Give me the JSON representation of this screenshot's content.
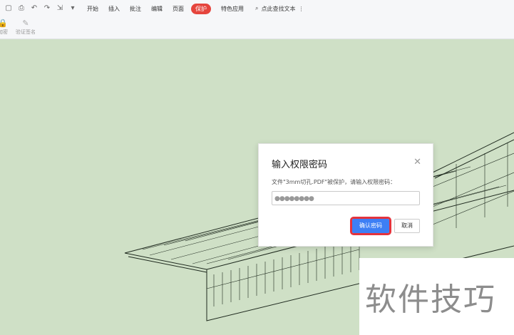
{
  "toolbar": {
    "menus": [
      "开始",
      "插入",
      "批注",
      "编辑",
      "页面",
      "保护",
      "特色应用"
    ],
    "active_menu": "保护",
    "search_label": "点此查找文本",
    "tools": [
      "加密",
      "验证签名"
    ]
  },
  "dialog": {
    "title": "输入权限密码",
    "message": "文件\"3mm切孔.PDF\"被保护，请输入权限密码：",
    "password_mask": "●●●●●●●●",
    "confirm_label": "确认密码",
    "cancel_label": "取消"
  },
  "watermark": {
    "text": "软件技巧"
  },
  "colors": {
    "accent": "#e4333d",
    "primary": "#3d7ff5",
    "background": "#cfe0c6"
  }
}
